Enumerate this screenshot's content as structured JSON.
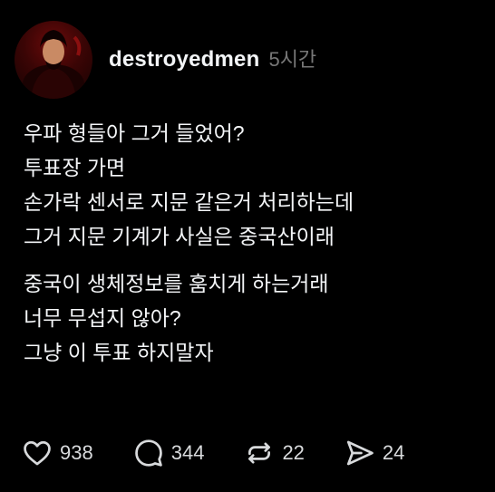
{
  "post": {
    "author": {
      "username": "destroyedmen",
      "timestamp": "5시간"
    },
    "paragraphs": [
      {
        "lines": [
          "우파 형들아 그거 들었어?",
          "투표장 가면",
          "손가락 센서로 지문 같은거 처리하는데",
          "그거 지문 기계가 사실은 중국산이래"
        ]
      },
      {
        "lines": [
          "중국이 생체정보를 훔치게 하는거래",
          "너무 무섭지 않아?",
          "그냥 이 투표 하지말자"
        ]
      }
    ],
    "actions": {
      "like": {
        "icon": "heart-icon",
        "count": "938"
      },
      "reply": {
        "icon": "comment-icon",
        "count": "344"
      },
      "repost": {
        "icon": "repost-icon",
        "count": "22"
      },
      "share": {
        "icon": "send-icon",
        "count": "24"
      }
    }
  }
}
